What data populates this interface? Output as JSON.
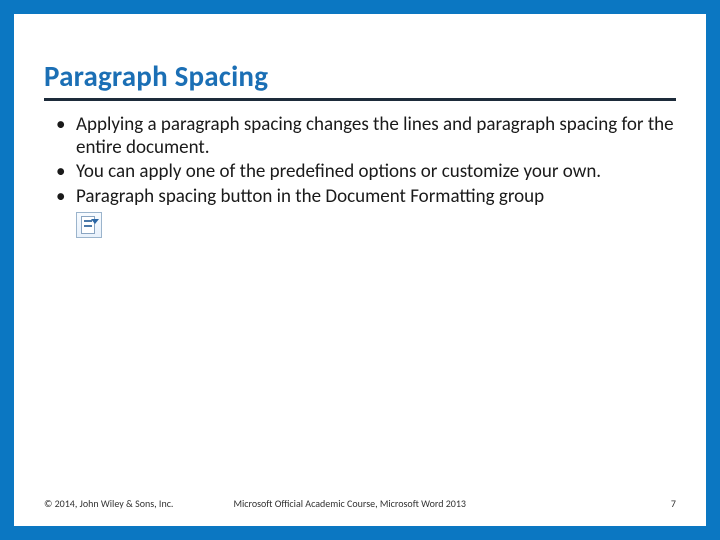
{
  "title": "Paragraph Spacing",
  "bullets": [
    "Applying a paragraph spacing changes the lines and paragraph spacing for the entire document.",
    "You can apply one of the predefined options or customize your own.",
    "Paragraph spacing button in the Document Formatting group"
  ],
  "icon_name": "paragraph-spacing-icon",
  "footer": {
    "copyright": "© 2014, John Wiley & Sons, Inc.",
    "course": "Microsoft Official Academic Course, Microsoft Word 2013",
    "page": "7"
  }
}
